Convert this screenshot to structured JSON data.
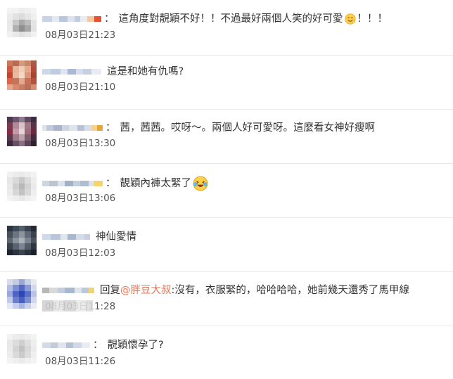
{
  "comments": [
    {
      "separator": "：",
      "parts": [
        {
          "type": "text",
          "value": "這角度對靚穎不好！！不過最好兩個人笑的好可愛"
        },
        {
          "type": "emoji",
          "icon": "smile-emoji-icon"
        },
        {
          "type": "text",
          "value": "！！！"
        }
      ],
      "timestamp": "08月03日21:23"
    },
    {
      "separator": "",
      "parts": [
        {
          "type": "text",
          "value": "這是和她有仇嗎?"
        }
      ],
      "timestamp": "08月03日21:10"
    },
    {
      "separator": "：",
      "parts": [
        {
          "type": "text",
          "value": "茜，茜茜。哎呀～。兩個人好可愛呀。這麼看女神好瘦啊"
        }
      ],
      "timestamp": "08月03日13:30"
    },
    {
      "separator": "：",
      "parts": [
        {
          "type": "text",
          "value": "靚穎內褲太緊了"
        },
        {
          "type": "emoji",
          "icon": "laughing-tears-emoji-icon"
        }
      ],
      "timestamp": "08月03日13:06"
    },
    {
      "separator": "",
      "parts": [
        {
          "type": "text",
          "value": "神仙愛情"
        }
      ],
      "timestamp": "08月03日12:03"
    },
    {
      "separator": "",
      "parts": [
        {
          "type": "text",
          "value": "回复"
        },
        {
          "type": "mention",
          "value": "@胖豆大叔"
        },
        {
          "type": "text",
          "value": ":沒有，衣服緊的，哈哈哈哈，她前幾天還秀了馬甲線"
        }
      ],
      "timestamp": "08月03日11:28"
    },
    {
      "separator": "：",
      "parts": [
        {
          "type": "text",
          "value": "靚穎懷孕了?"
        }
      ],
      "timestamp": "08月03日11:26"
    }
  ],
  "colors": {
    "text": "#333333",
    "timestamp": "#555555",
    "mention": "#eb7350",
    "divider": "#e8e8e8"
  }
}
